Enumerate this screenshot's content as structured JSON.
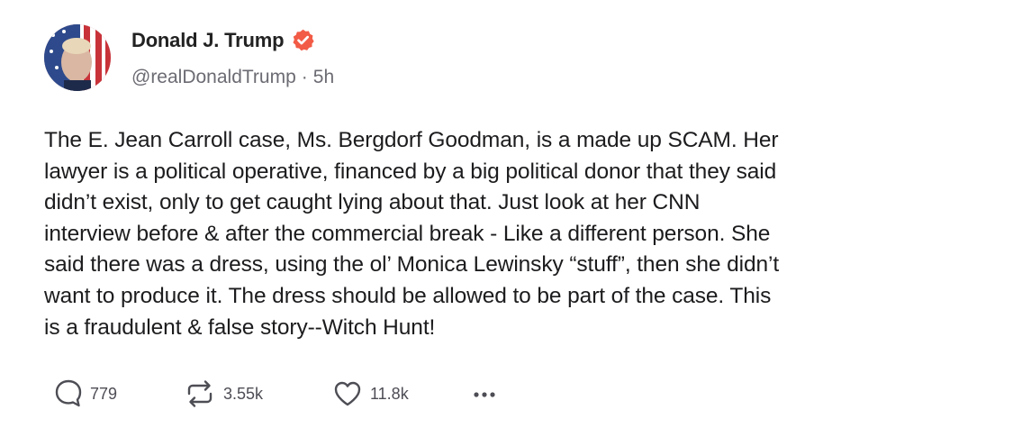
{
  "post": {
    "author": {
      "display_name": "Donald J. Trump",
      "verified": true,
      "handle": "@realDonaldTrump",
      "separator": "·",
      "time": "5h"
    },
    "text_lines": [
      "The E. Jean Carroll case, Ms. Bergdorf Goodman, is a made up SCAM. Her",
      "lawyer is a political operative, financed by a big political donor that they said",
      "didn’t exist, only to get caught lying about that. Just look at her CNN",
      "interview before & after the commercial break - Like a different person. She",
      "said there was a dress, using the ol’ Monica Lewinsky “stuff”, then she didn’t",
      "want to produce it. The dress should be allowed to be part of the case. This",
      "is a fraudulent & false story--Witch Hunt!"
    ],
    "actions": {
      "reply_count": "779",
      "retruth_count": "3.55k",
      "like_count": "11.8k"
    }
  },
  "icons": {
    "avatar": "profile-photo",
    "verified": "verified-badge-icon",
    "reply": "speech-bubble-icon",
    "retruth": "repost-arrows-icon",
    "like": "heart-icon",
    "more": "more-dots-icon"
  },
  "colors": {
    "verified_badge": "#f25b46",
    "text": "#1c1c1e",
    "secondary_text": "#6b6b73",
    "icon": "#4d4d55"
  }
}
